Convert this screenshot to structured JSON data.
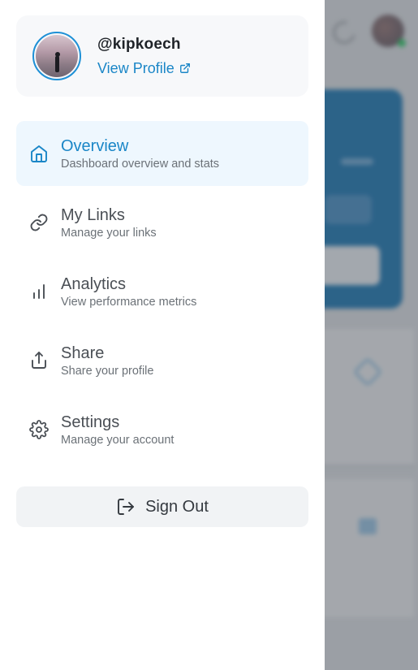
{
  "profile": {
    "handle": "@kipkoech",
    "view_profile_label": "View Profile"
  },
  "nav": {
    "items": [
      {
        "label": "Overview",
        "description": "Dashboard overview and stats",
        "icon": "home-icon",
        "active": true
      },
      {
        "label": "My Links",
        "description": "Manage your links",
        "icon": "link-icon",
        "active": false
      },
      {
        "label": "Analytics",
        "description": "View performance metrics",
        "icon": "bar-chart-icon",
        "active": false
      },
      {
        "label": "Share",
        "description": "Share your profile",
        "icon": "share-icon",
        "active": false
      },
      {
        "label": "Settings",
        "description": "Manage your account",
        "icon": "gear-icon",
        "active": false
      }
    ]
  },
  "signout": {
    "label": "Sign Out",
    "icon": "sign-out-icon"
  },
  "colors": {
    "accent": "#1a86c7",
    "active_bg": "#eef7fe",
    "hero": "#0f6fae"
  }
}
